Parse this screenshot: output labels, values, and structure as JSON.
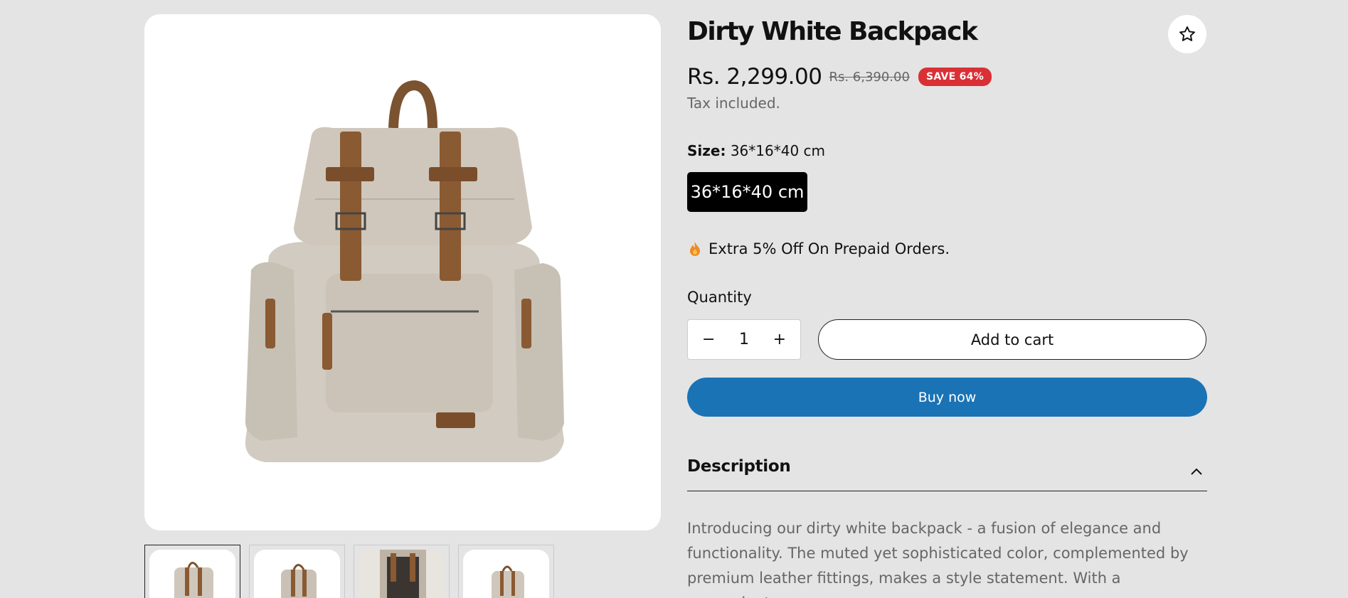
{
  "product": {
    "title": "Dirty White Backpack",
    "price": "Rs. 2,299.00",
    "compare_price": "Rs. 6,390.00",
    "badge": "SAVE 64%",
    "tax_note": "Tax included."
  },
  "size": {
    "label": "Size:",
    "selected_value": "36*16*40 cm",
    "options": [
      "36*16*40 cm"
    ]
  },
  "promo": {
    "text": "Extra 5% Off On Prepaid Orders.",
    "icon": "fire-icon"
  },
  "quantity": {
    "label": "Quantity",
    "value": "1",
    "minus": "−",
    "plus": "+"
  },
  "actions": {
    "add_to_cart": "Add to cart",
    "buy_now": "Buy now"
  },
  "description": {
    "heading": "Description",
    "text_lines": [
      "Introducing our dirty white backpack - a fusion of elegance and",
      "functionality. The muted yet sophisticated color, complemented by",
      "premium leather fittings, makes a style statement. With a convenient"
    ]
  },
  "gallery": {
    "thumbnail_count": 4,
    "active_index": 0
  },
  "colors": {
    "background": "#e4e4e4",
    "badge": "#d93036",
    "buy_now": "#1a73b5",
    "size_selected": "#000000",
    "canvas_beige": "#cfc8bd",
    "leather": "#8a5a32"
  }
}
